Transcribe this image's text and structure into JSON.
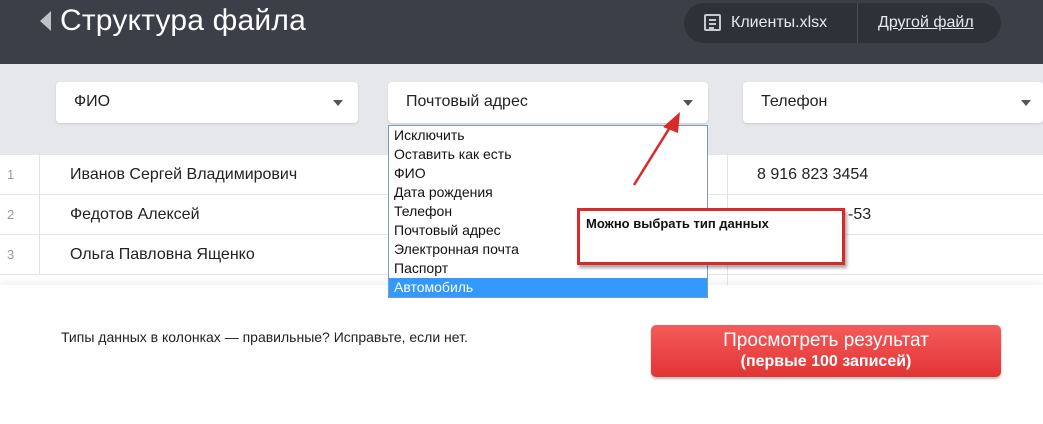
{
  "header": {
    "title": "Структура файла",
    "file_name": "Клиенты.xlsx",
    "other_file_label": "Другой файл"
  },
  "columns": [
    {
      "type": "ФИО"
    },
    {
      "type": "Почтовый адрес"
    },
    {
      "type": "Телефон"
    }
  ],
  "rows": [
    {
      "num": "1",
      "fio": "Иванов Сергей Владимирович",
      "phone": "8 916 823 3454"
    },
    {
      "num": "2",
      "fio": "Федотов Алексей",
      "phone": "-53"
    },
    {
      "num": "3",
      "fio": "Ольга Павловна Ященко",
      "phone": ""
    }
  ],
  "dropdown": {
    "options": [
      "Исключить",
      "Оставить как есть",
      "ФИО",
      "Дата рождения",
      "Телефон",
      "Почтовый адрес",
      "Электронная почта",
      "Паспорт",
      "Автомобиль"
    ],
    "highlighted": "Автомобиль"
  },
  "annotation": {
    "text": "Можно выбрать тип данных",
    "color": "#d92a2a"
  },
  "footer": {
    "hint": "Типы данных в колонках — правильные? Исправьте, если нет.",
    "button_line1": "Просмотреть результат",
    "button_line2": "(первые 100 записей)"
  },
  "colors": {
    "header_bg": "#3c3e48",
    "accent_button": "#e23434",
    "selection": "#3399ff"
  }
}
